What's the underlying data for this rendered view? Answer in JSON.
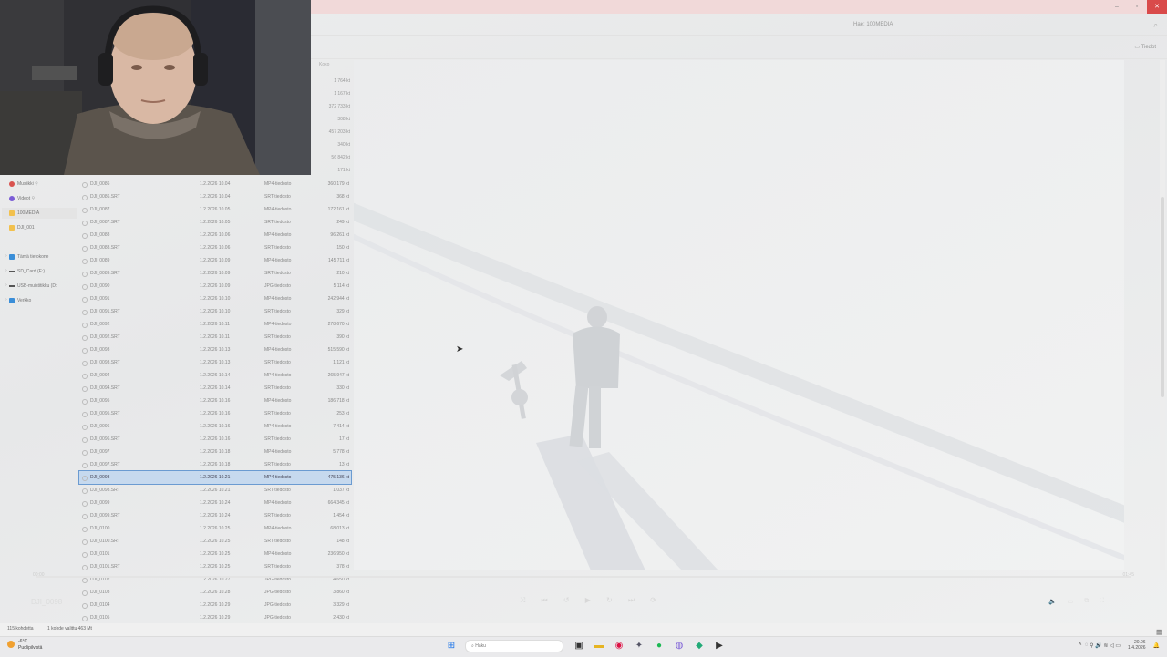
{
  "window": {
    "title": "Hae: 100MEDIA",
    "search_icon": "search-icon"
  },
  "toolbar": {
    "details_label": "Tiedot"
  },
  "columns": {
    "size_header": "Koko"
  },
  "top_sizes": [
    "1 764 kt",
    "1 167 kt",
    "372 733 kt",
    "308 kt",
    "457 203 kt",
    "340 kt",
    "56 842 kt",
    "171 kt"
  ],
  "nav": {
    "items": [
      {
        "label": "Musiikki",
        "color": "#d9534f"
      },
      {
        "label": "Videot",
        "color": "#7b5cd6"
      },
      {
        "label": "100MEDIA",
        "color": "#f2c14e"
      },
      {
        "label": "DJI_001",
        "color": "#f2c14e"
      },
      {
        "label": "Tämä tietokone",
        "color": "#3a8ed8"
      },
      {
        "label": "SD_Card (E:)",
        "color": "#555555"
      },
      {
        "label": "USB-muistitikku (D:",
        "color": "#555555"
      },
      {
        "label": "Verkko",
        "color": "#3a8ed8"
      }
    ]
  },
  "files": [
    {
      "name": "DJI_0086",
      "date": "1.2.2026 10.04",
      "type": "MP4-tiedosto",
      "size": "360 179 kt"
    },
    {
      "name": "DJI_0086.SRT",
      "date": "1.2.2026 10.04",
      "type": "SRT-tiedosto",
      "size": "368 kt"
    },
    {
      "name": "DJI_0087",
      "date": "1.2.2026 10.05",
      "type": "MP4-tiedosto",
      "size": "172 161 kt"
    },
    {
      "name": "DJI_0087.SRT",
      "date": "1.2.2026 10.05",
      "type": "SRT-tiedosto",
      "size": "249 kt"
    },
    {
      "name": "DJI_0088",
      "date": "1.2.2026 10.06",
      "type": "MP4-tiedosto",
      "size": "96 261 kt"
    },
    {
      "name": "DJI_0088.SRT",
      "date": "1.2.2026 10.06",
      "type": "SRT-tiedosto",
      "size": "150 kt"
    },
    {
      "name": "DJI_0089",
      "date": "1.2.2026 10.09",
      "type": "MP4-tiedosto",
      "size": "145 711 kt"
    },
    {
      "name": "DJI_0089.SRT",
      "date": "1.2.2026 10.09",
      "type": "SRT-tiedosto",
      "size": "210 kt"
    },
    {
      "name": "DJI_0090",
      "date": "1.2.2026 10.09",
      "type": "JPG-tiedosto",
      "size": "5 114 kt"
    },
    {
      "name": "DJI_0091",
      "date": "1.2.2026 10.10",
      "type": "MP4-tiedosto",
      "size": "242 944 kt"
    },
    {
      "name": "DJI_0091.SRT",
      "date": "1.2.2026 10.10",
      "type": "SRT-tiedosto",
      "size": "329 kt"
    },
    {
      "name": "DJI_0092",
      "date": "1.2.2026 10.11",
      "type": "MP4-tiedosto",
      "size": "278 670 kt"
    },
    {
      "name": "DJI_0092.SRT",
      "date": "1.2.2026 10.11",
      "type": "SRT-tiedosto",
      "size": "390 kt"
    },
    {
      "name": "DJI_0093",
      "date": "1.2.2026 10.13",
      "type": "MP4-tiedosto",
      "size": "515 590 kt"
    },
    {
      "name": "DJI_0093.SRT",
      "date": "1.2.2026 10.13",
      "type": "SRT-tiedosto",
      "size": "1 121 kt"
    },
    {
      "name": "DJI_0094",
      "date": "1.2.2026 10.14",
      "type": "MP4-tiedosto",
      "size": "265 947 kt"
    },
    {
      "name": "DJI_0094.SRT",
      "date": "1.2.2026 10.14",
      "type": "SRT-tiedosto",
      "size": "330 kt"
    },
    {
      "name": "DJI_0095",
      "date": "1.2.2026 10.16",
      "type": "MP4-tiedosto",
      "size": "186 718 kt"
    },
    {
      "name": "DJI_0095.SRT",
      "date": "1.2.2026 10.16",
      "type": "SRT-tiedosto",
      "size": "253 kt"
    },
    {
      "name": "DJI_0096",
      "date": "1.2.2026 10.16",
      "type": "MP4-tiedosto",
      "size": "7 414 kt"
    },
    {
      "name": "DJI_0096.SRT",
      "date": "1.2.2026 10.16",
      "type": "SRT-tiedosto",
      "size": "17 kt"
    },
    {
      "name": "DJI_0097",
      "date": "1.2.2026 10.18",
      "type": "MP4-tiedosto",
      "size": "5 778 kt"
    },
    {
      "name": "DJI_0097.SRT",
      "date": "1.2.2026 10.18",
      "type": "SRT-tiedosto",
      "size": "13 kt"
    },
    {
      "name": "DJI_0098",
      "date": "1.2.2026 10.21",
      "type": "MP4-tiedosto",
      "size": "475 136 kt",
      "selected": true
    },
    {
      "name": "DJI_0098.SRT",
      "date": "1.2.2026 10.21",
      "type": "SRT-tiedosto",
      "size": "1 037 kt"
    },
    {
      "name": "DJI_0099",
      "date": "1.2.2026 10.24",
      "type": "MP4-tiedosto",
      "size": "664 345 kt"
    },
    {
      "name": "DJI_0099.SRT",
      "date": "1.2.2026 10.24",
      "type": "SRT-tiedosto",
      "size": "1 454 kt"
    },
    {
      "name": "DJI_0100",
      "date": "1.2.2026 10.25",
      "type": "MP4-tiedosto",
      "size": "68 013 kt"
    },
    {
      "name": "DJI_0100.SRT",
      "date": "1.2.2026 10.25",
      "type": "SRT-tiedosto",
      "size": "148 kt"
    },
    {
      "name": "DJI_0101",
      "date": "1.2.2026 10.25",
      "type": "MP4-tiedosto",
      "size": "236 950 kt"
    },
    {
      "name": "DJI_0101.SRT",
      "date": "1.2.2026 10.25",
      "type": "SRT-tiedosto",
      "size": "378 kt"
    },
    {
      "name": "DJI_0102",
      "date": "1.2.2026 10.27",
      "type": "JPG-tiedosto",
      "size": "4 650 kt"
    },
    {
      "name": "DJI_0103",
      "date": "1.2.2026 10.28",
      "type": "JPG-tiedosto",
      "size": "3 860 kt"
    },
    {
      "name": "DJI_0104",
      "date": "1.2.2026 10.29",
      "type": "JPG-tiedosto",
      "size": "3 329 kt"
    },
    {
      "name": "DJI_0105",
      "date": "1.2.2026 10.29",
      "type": "JPG-tiedosto",
      "size": "2 430 kt"
    }
  ],
  "player": {
    "title": "DJI_0098",
    "time_left": "00:00",
    "time_right": "01:45"
  },
  "status": {
    "count": "115 kohdetta",
    "selection": "1 kohde valittu  463 Mt"
  },
  "taskbar": {
    "weather_temp": "-6°C",
    "weather_desc": "Puolipilvistä",
    "search_placeholder": "Haku",
    "time": "20.06",
    "date": "1.4.2026"
  }
}
